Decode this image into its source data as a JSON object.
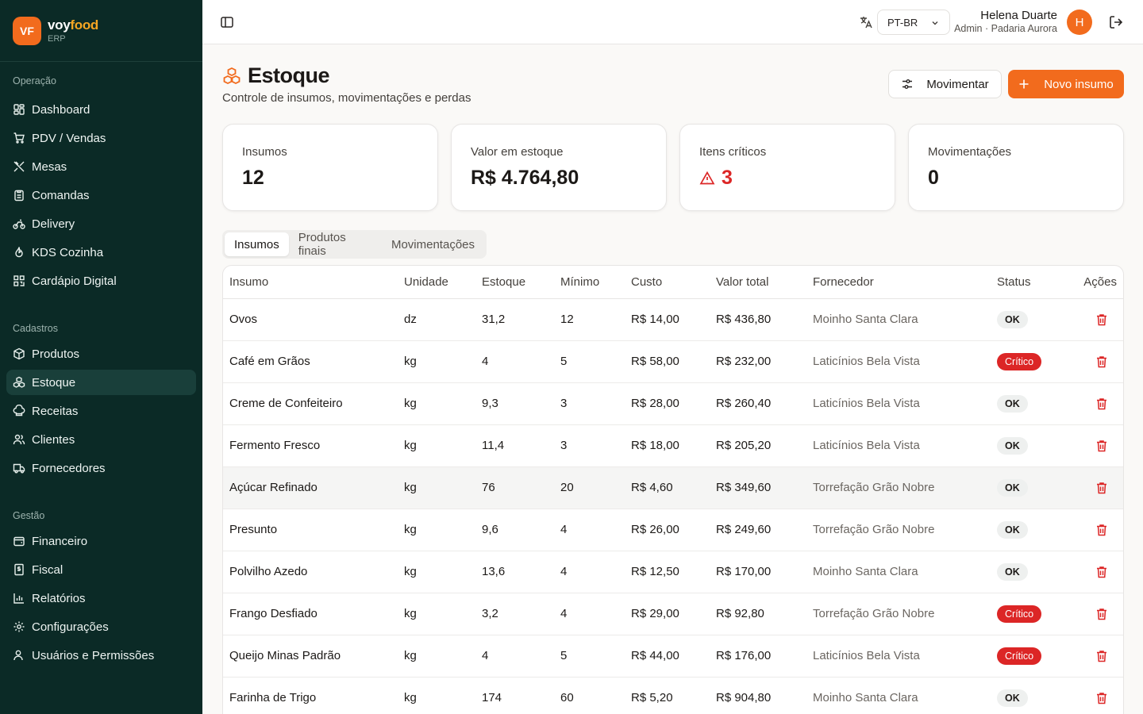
{
  "brand": {
    "logo": "VF",
    "name_part1": "voy",
    "name_part2": "food",
    "sub": "ERP"
  },
  "sidebar": {
    "sections": [
      {
        "title": "Operação",
        "items": [
          {
            "label": "Dashboard",
            "icon": "dashboard-icon"
          },
          {
            "label": "PDV / Vendas",
            "icon": "cart-icon"
          },
          {
            "label": "Mesas",
            "icon": "utensils-icon"
          },
          {
            "label": "Comandas",
            "icon": "clipboard-icon"
          },
          {
            "label": "Delivery",
            "icon": "bike-icon"
          },
          {
            "label": "KDS Cozinha",
            "icon": "flame-icon"
          },
          {
            "label": "Cardápio Digital",
            "icon": "qrcode-icon"
          }
        ]
      },
      {
        "title": "Cadastros",
        "items": [
          {
            "label": "Produtos",
            "icon": "box-icon"
          },
          {
            "label": "Estoque",
            "icon": "boxes-icon",
            "active": true
          },
          {
            "label": "Receitas",
            "icon": "chef-hat-icon"
          },
          {
            "label": "Clientes",
            "icon": "users-icon"
          },
          {
            "label": "Fornecedores",
            "icon": "truck-icon"
          }
        ]
      },
      {
        "title": "Gestão",
        "items": [
          {
            "label": "Financeiro",
            "icon": "wallet-icon"
          },
          {
            "label": "Fiscal",
            "icon": "receipt-icon"
          },
          {
            "label": "Relatórios",
            "icon": "bar-chart-icon"
          },
          {
            "label": "Configurações",
            "icon": "gear-icon"
          },
          {
            "label": "Usuários e Permissões",
            "icon": "user-cog-icon"
          }
        ]
      }
    ]
  },
  "topbar": {
    "language": "PT-BR",
    "user_name": "Helena Duarte",
    "user_role": "Admin · Padaria Aurora",
    "avatar_initial": "H"
  },
  "header": {
    "title": "Estoque",
    "subtitle": "Controle de insumos, movimentações e perdas",
    "move_button": "Movimentar",
    "new_button": "Novo insumo"
  },
  "stats": [
    {
      "label": "Insumos",
      "value": "12"
    },
    {
      "label": "Valor em estoque",
      "value": "R$ 4.764,80"
    },
    {
      "label": "Itens críticos",
      "value": "3"
    },
    {
      "label": "Movimentações",
      "value": "0"
    }
  ],
  "tabs": [
    "Insumos",
    "Produtos finais",
    "Movimentações"
  ],
  "table": {
    "columns": [
      "Insumo",
      "Unidade",
      "Estoque",
      "Mínimo",
      "Custo",
      "Valor total",
      "Fornecedor",
      "Status",
      "Ações"
    ],
    "rows": [
      [
        "Ovos",
        "dz",
        "31,2",
        "12",
        "R$ 14,00",
        "R$ 436,80",
        "Moinho Santa Clara",
        "OK"
      ],
      [
        "Café em Grãos",
        "kg",
        "4",
        "5",
        "R$ 58,00",
        "R$ 232,00",
        "Laticínios Bela Vista",
        "Crítico"
      ],
      [
        "Creme de Confeiteiro",
        "kg",
        "9,3",
        "3",
        "R$ 28,00",
        "R$ 260,40",
        "Laticínios Bela Vista",
        "OK"
      ],
      [
        "Fermento Fresco",
        "kg",
        "11,4",
        "3",
        "R$ 18,00",
        "R$ 205,20",
        "Laticínios Bela Vista",
        "OK"
      ],
      [
        "Açúcar Refinado",
        "kg",
        "76",
        "20",
        "R$ 4,60",
        "R$ 349,60",
        "Torrefação Grão Nobre",
        "OK"
      ],
      [
        "Presunto",
        "kg",
        "9,6",
        "4",
        "R$ 26,00",
        "R$ 249,60",
        "Torrefação Grão Nobre",
        "OK"
      ],
      [
        "Polvilho Azedo",
        "kg",
        "13,6",
        "4",
        "R$ 12,50",
        "R$ 170,00",
        "Moinho Santa Clara",
        "OK"
      ],
      [
        "Frango Desfiado",
        "kg",
        "3,2",
        "4",
        "R$ 29,00",
        "R$ 92,80",
        "Torrefação Grão Nobre",
        "Crítico"
      ],
      [
        "Queijo Minas Padrão",
        "kg",
        "4",
        "5",
        "R$ 44,00",
        "R$ 176,00",
        "Laticínios Bela Vista",
        "Crítico"
      ],
      [
        "Farinha de Trigo",
        "kg",
        "174",
        "60",
        "R$ 5,20",
        "R$ 904,80",
        "Moinho Santa Clara",
        "OK"
      ]
    ]
  },
  "colors": {
    "sidebar_bg": "#0b2a26",
    "accent": "#f26b1d",
    "critical": "#dc2626"
  }
}
